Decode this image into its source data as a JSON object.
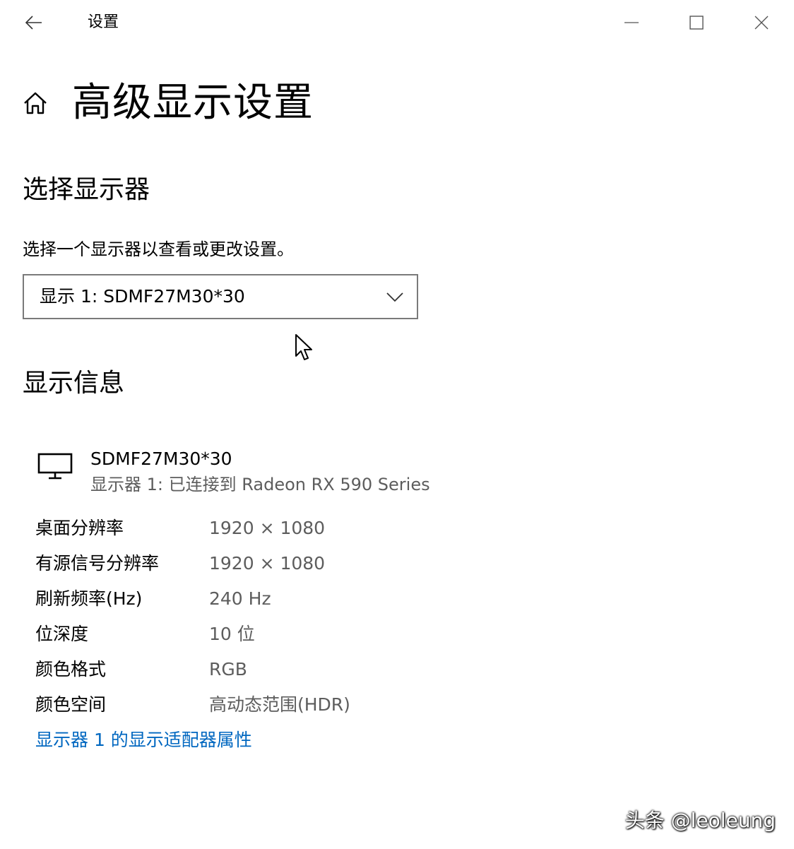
{
  "window": {
    "title": "设置",
    "back_icon": "arrow-left-icon",
    "controls": [
      "minimize-icon",
      "maximize-icon",
      "close-icon"
    ]
  },
  "page": {
    "home_icon": "home-icon",
    "title": "高级显示设置"
  },
  "select_display": {
    "heading": "选择显示器",
    "hint": "选择一个显示器以查看或更改设置。",
    "dropdown": {
      "selected": "显示 1: SDMF27M30*30",
      "icon": "chevron-down-icon"
    }
  },
  "display_info": {
    "heading": "显示信息",
    "monitor": {
      "icon": "monitor-icon",
      "name": "SDMF27M30*30",
      "connection": "显示器 1: 已连接到 Radeon RX 590 Series"
    },
    "rows": [
      {
        "label": "桌面分辨率",
        "value": "1920 × 1080"
      },
      {
        "label": "有源信号分辨率",
        "value": "1920 × 1080"
      },
      {
        "label": "刷新频率(Hz)",
        "value": "240 Hz"
      },
      {
        "label": "位深度",
        "value": "10 位"
      },
      {
        "label": "颜色格式",
        "value": "RGB"
      },
      {
        "label": "颜色空间",
        "value": "高动态范围(HDR)"
      }
    ],
    "adapter_link": "显示器 1 的显示适配器属性"
  },
  "watermark": "头条 @leoleung",
  "colors": {
    "background": "#ffffff",
    "text": "#000000",
    "secondary_text": "#5d5d5d",
    "link": "#0067c0",
    "border": "#7a7a7a"
  }
}
